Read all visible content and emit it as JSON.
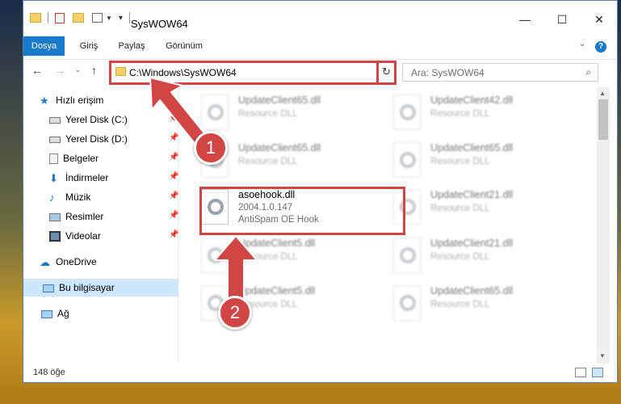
{
  "window": {
    "title": "SysWOW64",
    "controls": {
      "minimize": "—",
      "maximize": "☐",
      "close": "✕"
    }
  },
  "ribbon": {
    "tabs": [
      "Dosya",
      "Giriş",
      "Paylaş",
      "Görünüm"
    ]
  },
  "address": {
    "path": "C:\\Windows\\SysWOW64",
    "search_placeholder": "Ara: SysWOW64"
  },
  "sidebar": {
    "items": [
      {
        "label": "Hızlı erişim",
        "icon": "star-icon"
      },
      {
        "label": "Yerel Disk (C:)",
        "icon": "drive-icon"
      },
      {
        "label": "Yerel Disk (D:)",
        "icon": "drive-icon"
      },
      {
        "label": "Belgeler",
        "icon": "documents-icon"
      },
      {
        "label": "İndirmeler",
        "icon": "download-icon"
      },
      {
        "label": "Müzik",
        "icon": "music-icon"
      },
      {
        "label": "Resimler",
        "icon": "pictures-icon"
      },
      {
        "label": "Videolar",
        "icon": "videos-icon"
      },
      {
        "label": "OneDrive",
        "icon": "cloud-icon"
      },
      {
        "label": "Bu bilgisayar",
        "icon": "computer-icon"
      },
      {
        "label": "Ağ",
        "icon": "network-icon"
      }
    ]
  },
  "files": [
    {
      "name": "UpdateClient65.dll",
      "desc": "Resource DLL"
    },
    {
      "name": "UpdateClient42.dll",
      "desc": "Resource DLL"
    },
    {
      "name": "UpdateClient65.dll",
      "desc": "Resource DLL"
    },
    {
      "name": "UpdateClient65.dll",
      "desc": "Resource DLL"
    },
    {
      "name": "asoehook.dll",
      "version": "2004.1.0.147",
      "desc": "AntiSpam OE Hook"
    },
    {
      "name": "UpdateClient21.dll",
      "desc": "Resource DLL"
    },
    {
      "name": "UpdateClient5.dll",
      "desc": "Resource DLL"
    },
    {
      "name": "UpdateClient21.dll",
      "desc": "Resource DLL"
    },
    {
      "name": "UpdateClient5.dll",
      "desc": "Resource DLL"
    },
    {
      "name": "UpdateClient65.dll",
      "desc": "Resource DLL"
    }
  ],
  "status": {
    "count": "148 öğe"
  },
  "annotations": {
    "step1": "1",
    "step2": "2",
    "color": "#d24545"
  }
}
